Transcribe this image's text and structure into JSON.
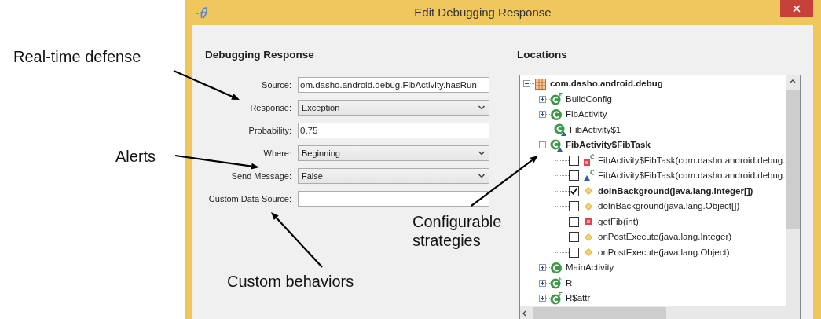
{
  "window": {
    "title": "Edit Debugging Response"
  },
  "response_panel": {
    "heading": "Debugging Response",
    "fields": [
      {
        "label": "Source:",
        "kind": "text",
        "value": "om.dasho.android.debug.FibActivity.hasRun"
      },
      {
        "label": "Response:",
        "kind": "combo",
        "value": "Exception"
      },
      {
        "label": "Probability:",
        "kind": "text",
        "value": "0.75"
      },
      {
        "label": "Where:",
        "kind": "combo",
        "value": "Beginning"
      },
      {
        "label": "Send Message:",
        "kind": "combo",
        "value": "False"
      },
      {
        "label": "Custom Data Source:",
        "kind": "text"
      }
    ]
  },
  "locations": {
    "heading": "Locations",
    "tree": [
      {
        "kind": "package",
        "label": "com.dasho.android.debug",
        "expanded": true,
        "bold": true,
        "children": [
          {
            "kind": "final-class",
            "label": "BuildConfig",
            "expanded": false,
            "bold": false
          },
          {
            "kind": "class",
            "label": "FibActivity",
            "expanded": false,
            "bold": false
          },
          {
            "kind": "inner-class",
            "label": "FibActivity$1",
            "bold": false
          },
          {
            "kind": "inner-class",
            "label": "FibActivity$FibTask",
            "expanded": true,
            "bold": true,
            "children": [
              {
                "kind": "private-constructor",
                "label": "FibActivity$FibTask(com.dasho.android.debug.",
                "checked": false,
                "bold": false
              },
              {
                "kind": "constructor",
                "label": "FibActivity$FibTask(com.dasho.android.debug.",
                "checked": false,
                "bold": false
              },
              {
                "kind": "method",
                "label": "doInBackground(java.lang.Integer[])",
                "checked": true,
                "bold": true
              },
              {
                "kind": "method",
                "label": "doInBackground(java.lang.Object[])",
                "checked": false,
                "bold": false
              },
              {
                "kind": "private-method",
                "label": "getFib(int)",
                "checked": false,
                "bold": false
              },
              {
                "kind": "method",
                "label": "onPostExecute(java.lang.Integer)",
                "checked": false,
                "bold": false
              },
              {
                "kind": "method",
                "label": "onPostExecute(java.lang.Object)",
                "checked": false,
                "bold": false
              }
            ]
          },
          {
            "kind": "class",
            "label": "MainActivity",
            "expanded": false,
            "bold": false
          },
          {
            "kind": "final-class",
            "label": "R",
            "expanded": false,
            "bold": false
          },
          {
            "kind": "final-class",
            "label": "R$attr",
            "expanded": false,
            "bold": false
          }
        ]
      }
    ]
  },
  "annotations": [
    {
      "text": "Real-time defense"
    },
    {
      "text": "Alerts"
    },
    {
      "text": "Configurable strategies"
    },
    {
      "text": "Custom behaviors"
    }
  ]
}
